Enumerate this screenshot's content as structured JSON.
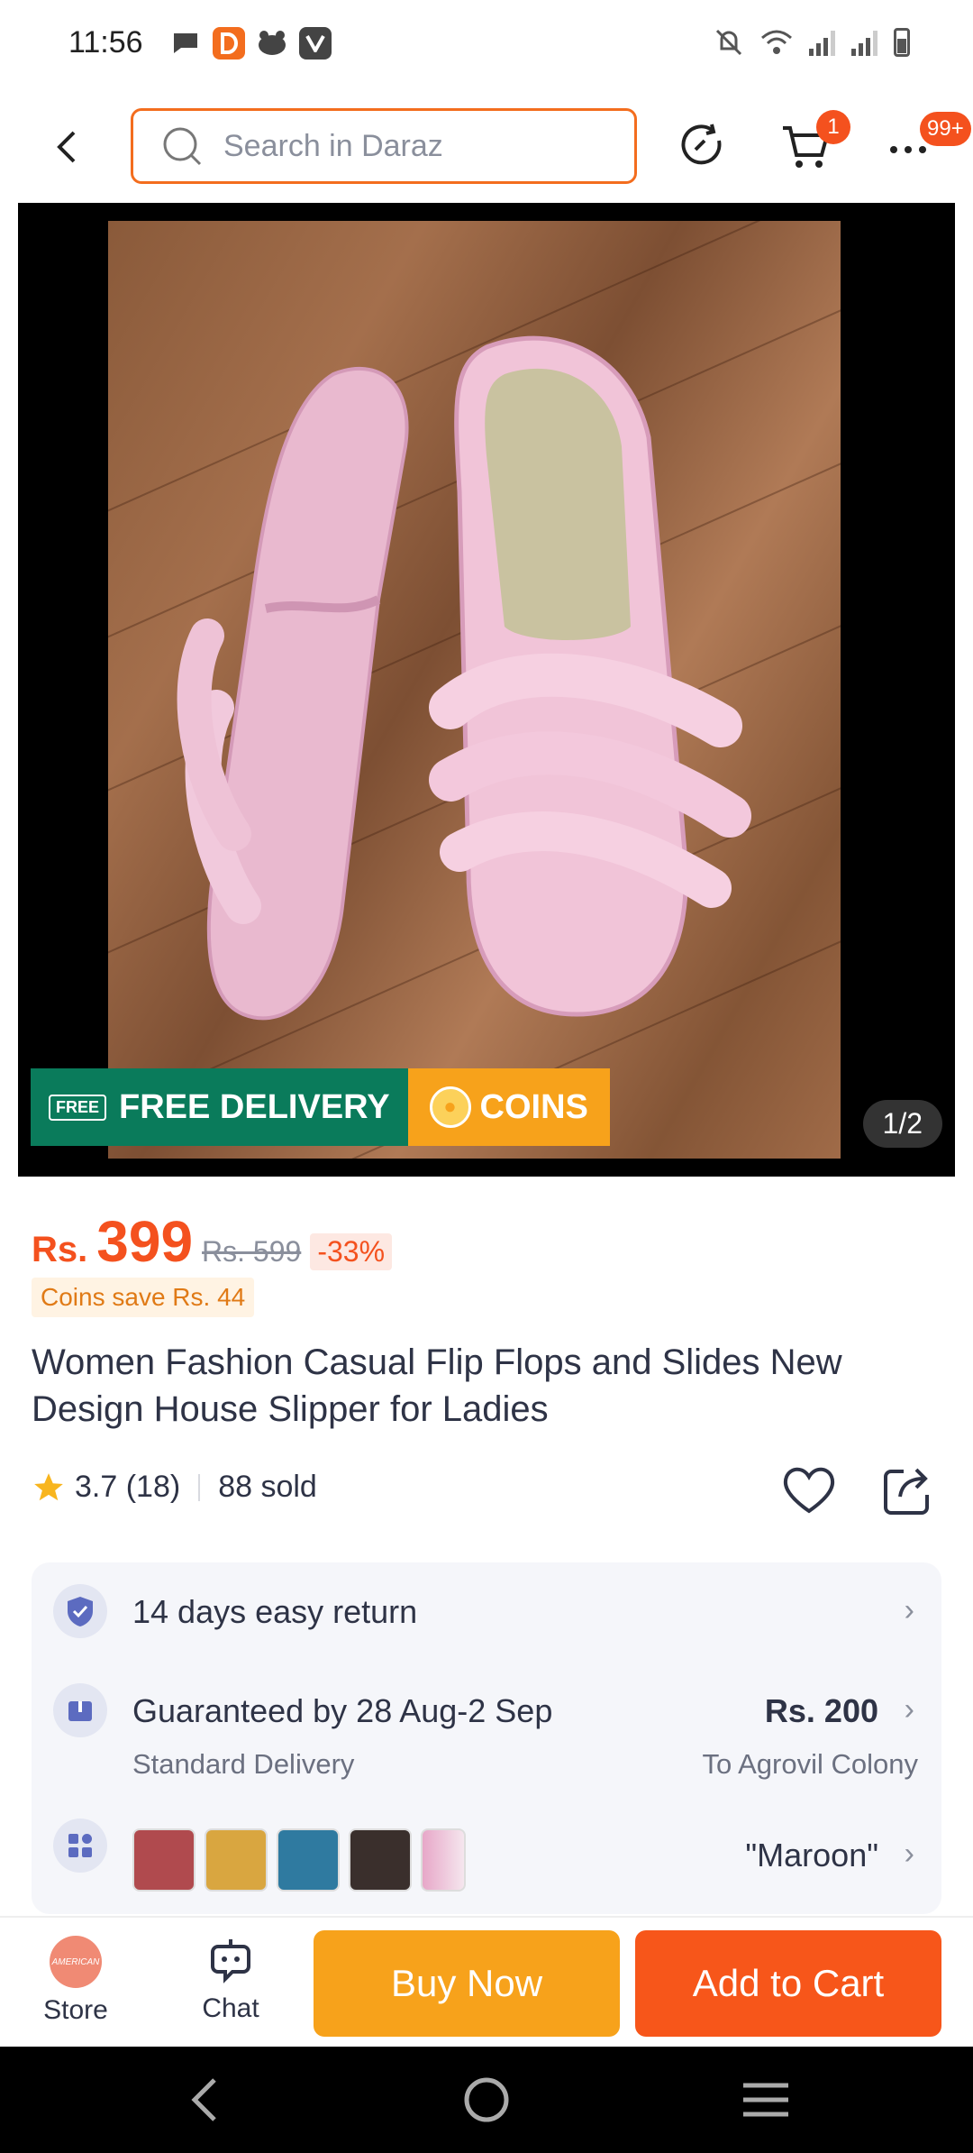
{
  "status_bar": {
    "time": "11:56"
  },
  "header": {
    "search_placeholder": "Search in Daraz",
    "cart_badge": "1",
    "more_badge": "99+"
  },
  "gallery": {
    "free_delivery": "FREE DELIVERY",
    "free_tag": "FREE",
    "coins": "COINS",
    "counter": "1/2"
  },
  "price": {
    "currency": "Rs.",
    "value": "399",
    "old": "Rs. 599",
    "discount": "-33%",
    "coins_save": "Coins save Rs. 44"
  },
  "product": {
    "title": "Women Fashion Casual Flip Flops and Slides New Design House Slipper for Ladies",
    "rating": "3.7 (18)",
    "sold": "88 sold"
  },
  "info": {
    "return": "14 days easy return",
    "delivery": "Guaranteed by 28 Aug-2 Sep",
    "delivery_type": "Standard Delivery",
    "delivery_price": "Rs. 200",
    "delivery_location": "To Agrovil Colony",
    "variant": "\"Maroon\"",
    "swatch_colors": [
      "#b04a4e",
      "#d9a640",
      "#2f7aa0",
      "#3a2f2c",
      "#e7a7c8"
    ]
  },
  "bottom_bar": {
    "store": "Store",
    "store_logo_text": "AMERICAN",
    "chat": "Chat",
    "buy_now": "Buy Now",
    "add_to_cart": "Add to Cart"
  },
  "colors": {
    "accent": "#f4511e",
    "buy_now": "#f7a21b",
    "add_to_cart": "#f7561a",
    "free_delivery": "#0a7b5b"
  }
}
